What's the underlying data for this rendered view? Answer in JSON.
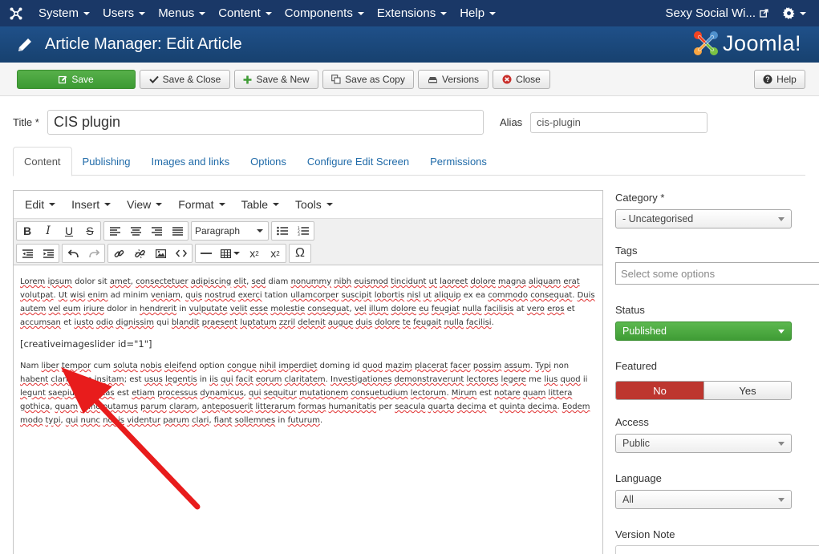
{
  "topnav": {
    "items": [
      "System",
      "Users",
      "Menus",
      "Content",
      "Components",
      "Extensions",
      "Help"
    ],
    "site_name": "Sexy Social Wi..."
  },
  "header": {
    "title": "Article Manager: Edit Article",
    "brand": "Joomla!"
  },
  "toolbar": {
    "save": "Save",
    "save_close": "Save & Close",
    "save_new": "Save & New",
    "save_copy": "Save as Copy",
    "versions": "Versions",
    "close": "Close",
    "help": "Help"
  },
  "form": {
    "title_label": "Title *",
    "title_value": "CIS plugin",
    "alias_label": "Alias",
    "alias_value": "cis-plugin"
  },
  "tabs": [
    "Content",
    "Publishing",
    "Images and links",
    "Options",
    "Configure Edit Screen",
    "Permissions"
  ],
  "editor": {
    "menus": [
      "Edit",
      "Insert",
      "View",
      "Format",
      "Table",
      "Tools"
    ],
    "block_format": "Paragraph",
    "shortcode": "[creativeimageslider id=\"1\"]"
  },
  "sidebar": {
    "category_label": "Category *",
    "category_value": "- Uncategorised",
    "tags_label": "Tags",
    "tags_placeholder": "Select some options",
    "status_label": "Status",
    "status_value": "Published",
    "featured_label": "Featured",
    "featured_no": "No",
    "featured_yes": "Yes",
    "access_label": "Access",
    "access_value": "Public",
    "language_label": "Language",
    "language_value": "All",
    "version_note_label": "Version Note"
  },
  "colors": {
    "nav_bg": "#1a3867",
    "header_bg": "#1f5089",
    "save_green": "#4cae3f",
    "featured_no_red": "#bd362f",
    "annotation_arrow": "#e81c1c"
  }
}
